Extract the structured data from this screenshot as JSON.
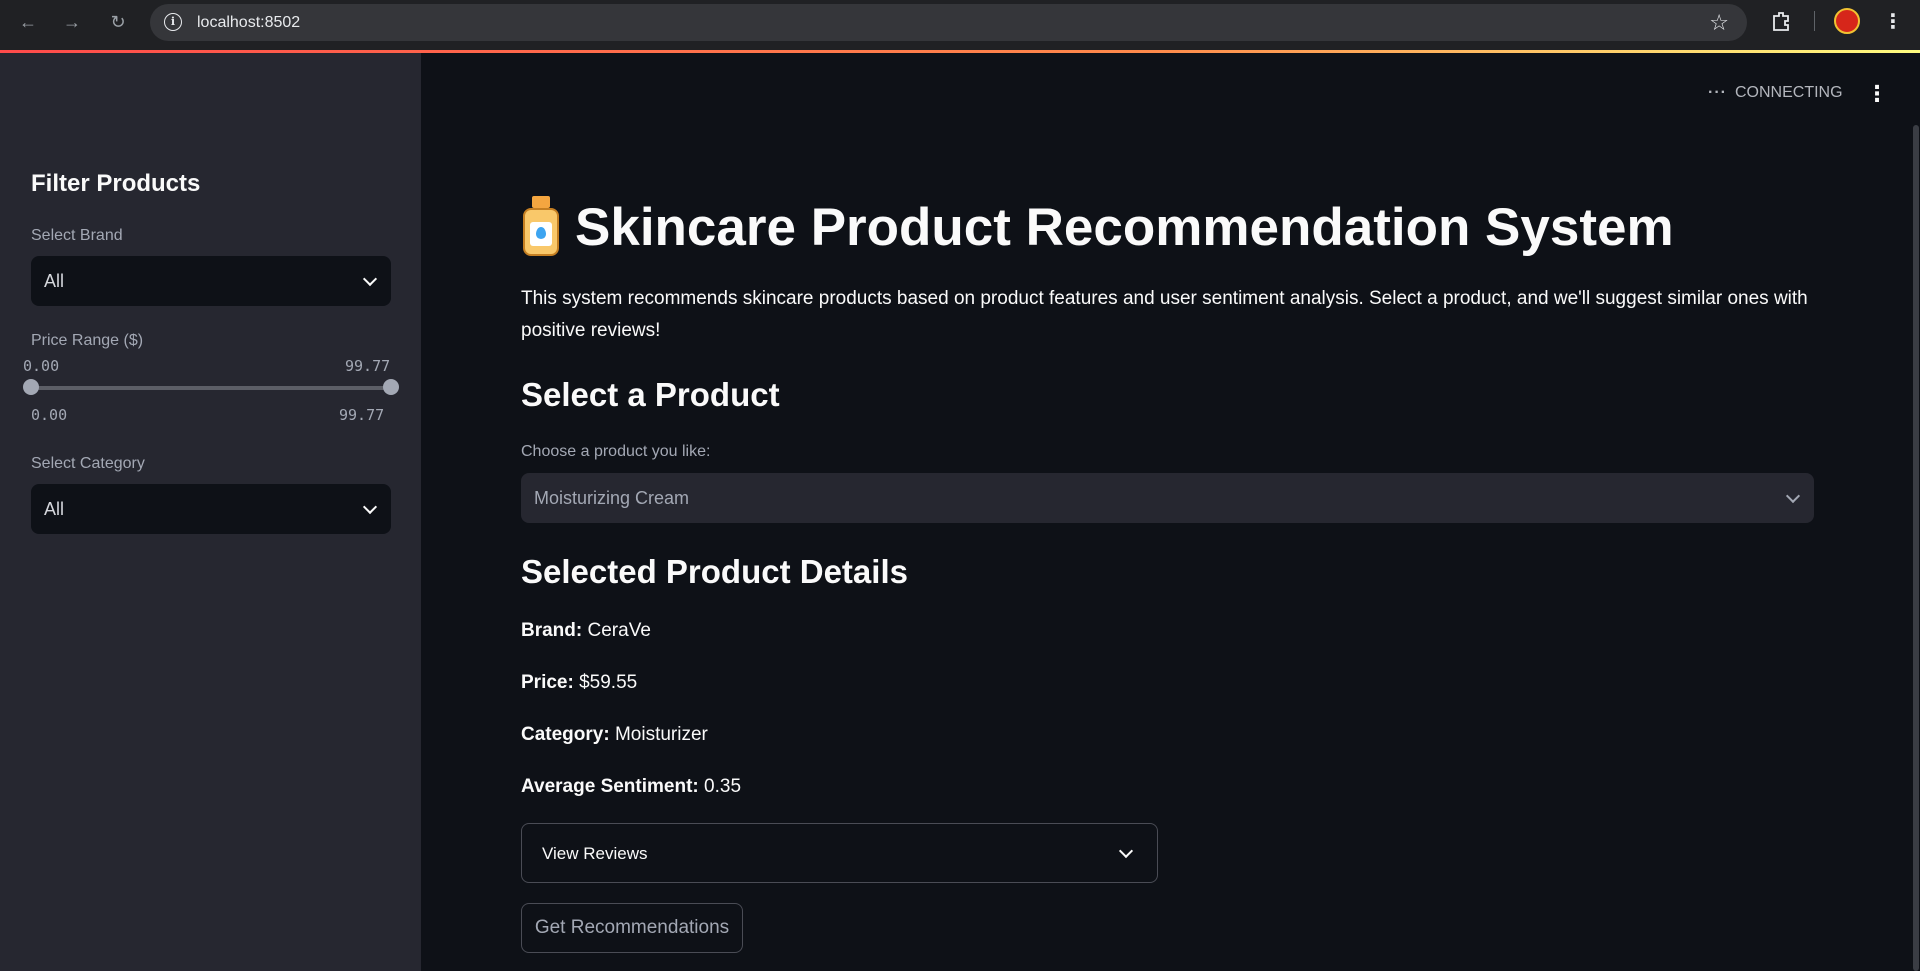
{
  "browser": {
    "url": "localhost:8502"
  },
  "sidebar": {
    "title": "Filter Products",
    "brand_label": "Select Brand",
    "brand_value": "All",
    "price_label": "Price Range ($)",
    "price_min_top": "0.00",
    "price_max_top": "99.77",
    "price_min": "0.00",
    "price_max": "99.77",
    "category_label": "Select Category",
    "category_value": "All"
  },
  "header": {
    "status": "CONNECTING"
  },
  "main": {
    "title": "Skincare Product Recommendation System",
    "description": "This system recommends skincare products based on product features and user sentiment analysis. Select a product, and we'll suggest similar ones with positive reviews!",
    "select_heading": "Select a Product",
    "select_label": "Choose a product you like:",
    "select_value": "Moisturizing Cream",
    "details_heading": "Selected Product Details",
    "brand_key": "Brand:",
    "brand_val": "CeraVe",
    "price_key": "Price:",
    "price_val": "$59.55",
    "category_key": "Category:",
    "category_val": "Moisturizer",
    "sentiment_key": "Average Sentiment:",
    "sentiment_val": "0.35",
    "reviews_label": "View Reviews",
    "recommend_button": "Get Recommendations"
  }
}
